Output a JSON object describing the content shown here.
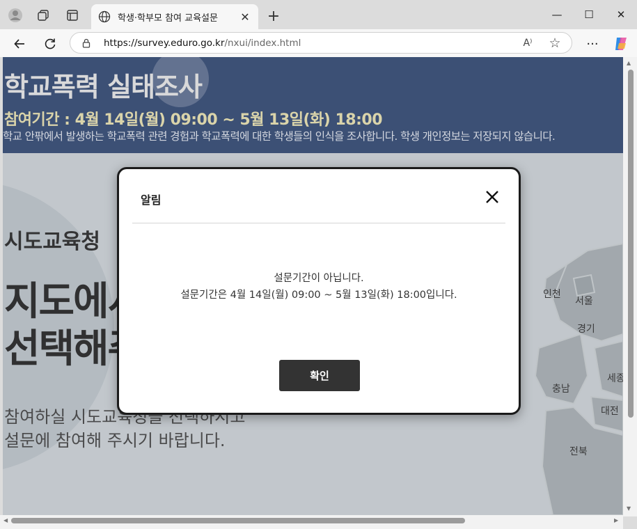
{
  "browser": {
    "tab_title": "학생·학부모 참여 교육설문",
    "tab_close": "✕",
    "new_tab": "+",
    "minimize": "—",
    "maximize": "☐",
    "close": "✕",
    "url_host": "https://survey.eduro.go.kr",
    "url_path": "/nxui/index.html",
    "read_aloud": "A⁾",
    "favorite": "☆",
    "more": "···"
  },
  "hero": {
    "title": "학교폭력 실태조사",
    "period": "참여기간 : 4월 14일(월) 09:00 ~ 5월 13일(화) 18:00",
    "description": "학교 안팎에서 발생하는 학교폭력 관련 경험과 학교폭력에 대한 학생들의 인식을 조사합니다. 학생 개인정보는 저장되지 않습니다."
  },
  "page": {
    "region_title": "시도교육청",
    "heading_line1": "지도에서",
    "heading_line2": "선택해주",
    "sub_line1": "참여하실 시도교육청을 선택하시고",
    "sub_line2": "설문에 참여해 주시기 바랍니다.",
    "map_labels": [
      "인천",
      "서울",
      "경기",
      "충남",
      "세종",
      "대전",
      "전북"
    ]
  },
  "modal": {
    "title": "알림",
    "message_line1": "설문기간이 아닙니다.",
    "message_line2": "설문기간은 4월 14일(월) 09:00 ~ 5월 13일(화) 18:00입니다.",
    "confirm_label": "확인"
  },
  "colors": {
    "hero_bg": "#344a74",
    "period_text": "#e8e1b0",
    "button_bg": "#333333"
  }
}
